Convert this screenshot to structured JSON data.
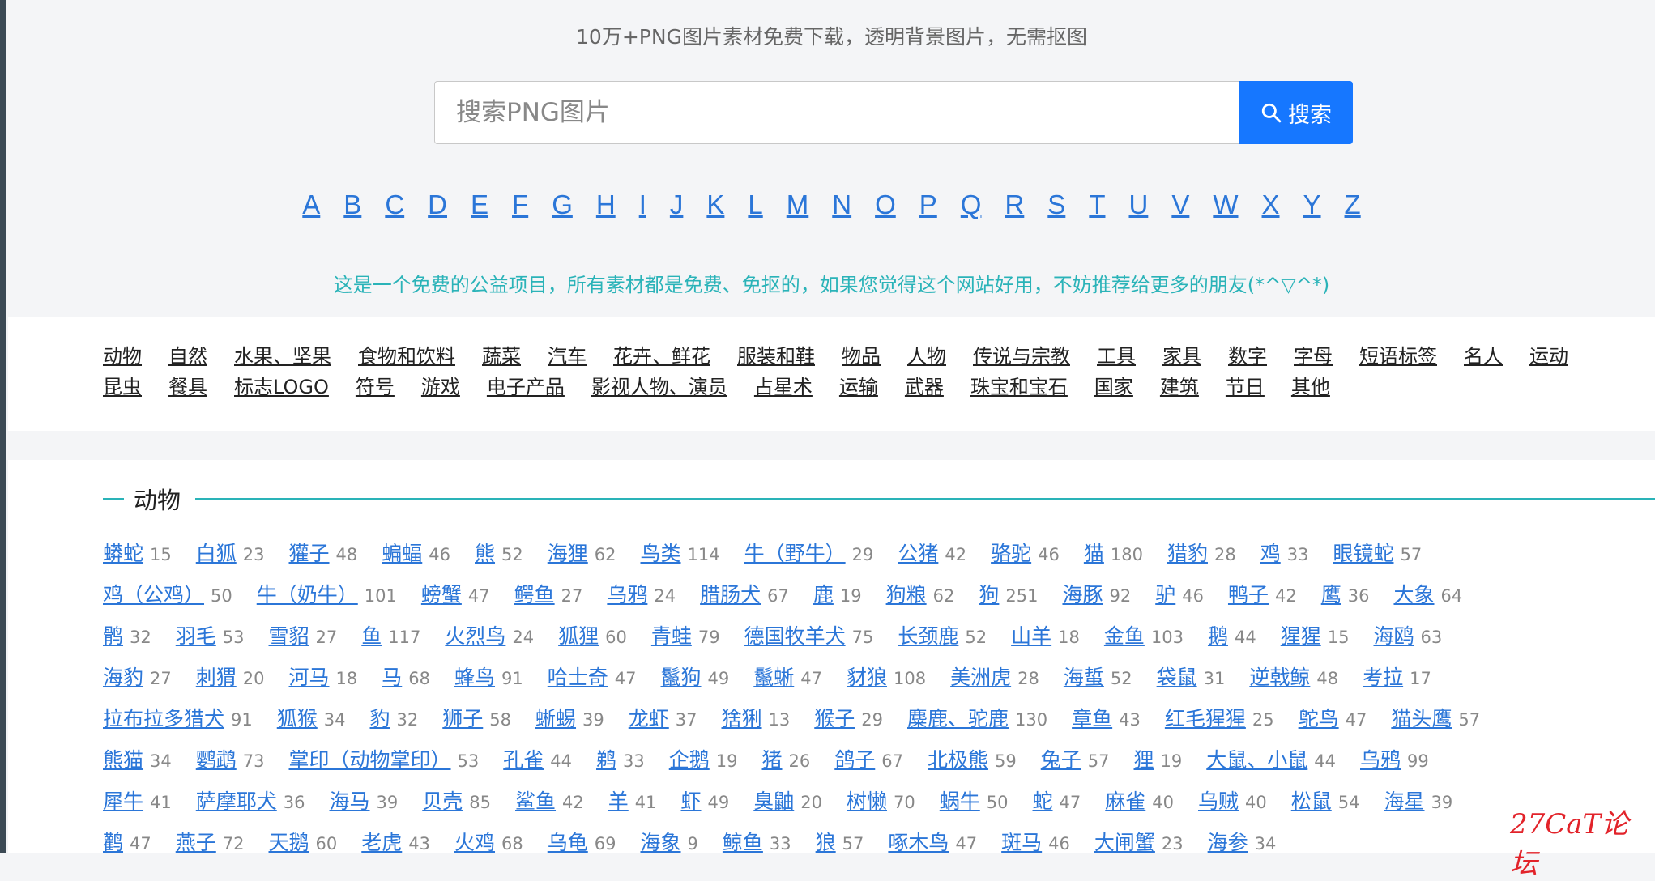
{
  "header": {
    "tagline": "10万+PNG图片素材免费下载，透明背景图片，无需抠图"
  },
  "search": {
    "placeholder": "搜索PNG图片",
    "button_label": "搜索",
    "icon": "search-icon"
  },
  "letters": [
    "A",
    "B",
    "C",
    "D",
    "E",
    "F",
    "G",
    "H",
    "I",
    "J",
    "K",
    "L",
    "M",
    "N",
    "O",
    "P",
    "Q",
    "R",
    "S",
    "T",
    "U",
    "V",
    "W",
    "X",
    "Y",
    "Z"
  ],
  "notice": "这是一个免费的公益项目，所有素材都是免费、免抠的，如果您觉得这个网站好用，不妨推荐给更多的朋友(*^▽^*)",
  "categories": [
    [
      "动物",
      "自然",
      "水果、坚果",
      "食物和饮料",
      "蔬菜",
      "汽车",
      "花卉、鲜花",
      "服装和鞋",
      "物品",
      "人物",
      "传说与宗教",
      "工具",
      "家具",
      "数字",
      "字母",
      "短语标签",
      "名人",
      "运动"
    ],
    [
      "昆虫",
      "餐具",
      "标志LOGO",
      "符号",
      "游戏",
      "电子产品",
      "影视人物、演员",
      "占星术",
      "运输",
      "武器",
      "珠宝和宝石",
      "国家",
      "建筑",
      "节日",
      "其他"
    ]
  ],
  "section": {
    "title": "动物",
    "rows": [
      [
        [
          "蟒蛇",
          "15"
        ],
        [
          "白狐",
          "23"
        ],
        [
          "獾子",
          "48"
        ],
        [
          "蝙蝠",
          "46"
        ],
        [
          "熊",
          "52"
        ],
        [
          "海狸",
          "62"
        ],
        [
          "鸟类",
          "114"
        ],
        [
          "牛（野牛）",
          "29"
        ],
        [
          "公猪",
          "42"
        ],
        [
          "骆驼",
          "46"
        ],
        [
          "猫",
          "180"
        ],
        [
          "猎豹",
          "28"
        ],
        [
          "鸡",
          "33"
        ],
        [
          "眼镜蛇",
          "57"
        ]
      ],
      [
        [
          "鸡（公鸡）",
          "50"
        ],
        [
          "牛（奶牛）",
          "101"
        ],
        [
          "螃蟹",
          "47"
        ],
        [
          "鳄鱼",
          "27"
        ],
        [
          "乌鸦",
          "24"
        ],
        [
          "腊肠犬",
          "67"
        ],
        [
          "鹿",
          "19"
        ],
        [
          "狗粮",
          "62"
        ],
        [
          "狗",
          "251"
        ],
        [
          "海豚",
          "92"
        ],
        [
          "驴",
          "46"
        ],
        [
          "鸭子",
          "42"
        ],
        [
          "鹰",
          "36"
        ],
        [
          "大象",
          "64"
        ]
      ],
      [
        [
          "鹘",
          "32"
        ],
        [
          "羽毛",
          "53"
        ],
        [
          "雪貂",
          "27"
        ],
        [
          "鱼",
          "117"
        ],
        [
          "火烈鸟",
          "24"
        ],
        [
          "狐狸",
          "60"
        ],
        [
          "青蛙",
          "79"
        ],
        [
          "德国牧羊犬",
          "75"
        ],
        [
          "长颈鹿",
          "52"
        ],
        [
          "山羊",
          "18"
        ],
        [
          "金鱼",
          "103"
        ],
        [
          "鹅",
          "44"
        ],
        [
          "猩猩",
          "15"
        ],
        [
          "海鸥",
          "63"
        ]
      ],
      [
        [
          "海豹",
          "27"
        ],
        [
          "刺猬",
          "20"
        ],
        [
          "河马",
          "18"
        ],
        [
          "马",
          "68"
        ],
        [
          "蜂鸟",
          "91"
        ],
        [
          "哈士奇",
          "47"
        ],
        [
          "鬣狗",
          "49"
        ],
        [
          "鬣蜥",
          "47"
        ],
        [
          "豺狼",
          "108"
        ],
        [
          "美洲虎",
          "28"
        ],
        [
          "海蜇",
          "52"
        ],
        [
          "袋鼠",
          "31"
        ],
        [
          "逆戟鲸",
          "48"
        ],
        [
          "考拉",
          "17"
        ]
      ],
      [
        [
          "拉布拉多猎犬",
          "91"
        ],
        [
          "狐猴",
          "34"
        ],
        [
          "豹",
          "32"
        ],
        [
          "狮子",
          "58"
        ],
        [
          "蜥蜴",
          "39"
        ],
        [
          "龙虾",
          "37"
        ],
        [
          "猞猁",
          "13"
        ],
        [
          "猴子",
          "29"
        ],
        [
          "麋鹿、驼鹿",
          "130"
        ],
        [
          "章鱼",
          "43"
        ],
        [
          "红毛猩猩",
          "25"
        ],
        [
          "鸵鸟",
          "47"
        ],
        [
          "猫头鹰",
          "57"
        ]
      ],
      [
        [
          "熊猫",
          "34"
        ],
        [
          "鹦鹉",
          "73"
        ],
        [
          "掌印（动物掌印）",
          "53"
        ],
        [
          "孔雀",
          "44"
        ],
        [
          "鹈",
          "33"
        ],
        [
          "企鹅",
          "19"
        ],
        [
          "猪",
          "26"
        ],
        [
          "鸽子",
          "67"
        ],
        [
          "北极熊",
          "59"
        ],
        [
          "兔子",
          "57"
        ],
        [
          "狸",
          "19"
        ],
        [
          "大鼠、小鼠",
          "44"
        ],
        [
          "乌鸦",
          "99"
        ]
      ],
      [
        [
          "犀牛",
          "41"
        ],
        [
          "萨摩耶犬",
          "36"
        ],
        [
          "海马",
          "39"
        ],
        [
          "贝壳",
          "85"
        ],
        [
          "鲨鱼",
          "42"
        ],
        [
          "羊",
          "41"
        ],
        [
          "虾",
          "49"
        ],
        [
          "臭鼬",
          "20"
        ],
        [
          "树懒",
          "70"
        ],
        [
          "蜗牛",
          "50"
        ],
        [
          "蛇",
          "47"
        ],
        [
          "麻雀",
          "40"
        ],
        [
          "乌贼",
          "40"
        ],
        [
          "松鼠",
          "54"
        ],
        [
          "海星",
          "39"
        ]
      ],
      [
        [
          "鹳",
          "47"
        ],
        [
          "燕子",
          "72"
        ],
        [
          "天鹅",
          "60"
        ],
        [
          "老虎",
          "43"
        ],
        [
          "火鸡",
          "68"
        ],
        [
          "乌龟",
          "69"
        ],
        [
          "海象",
          "9"
        ],
        [
          "鲸鱼",
          "33"
        ],
        [
          "狼",
          "57"
        ],
        [
          "啄木鸟",
          "47"
        ],
        [
          "斑马",
          "46"
        ],
        [
          "大闸蟹",
          "23"
        ],
        [
          "海参",
          "34"
        ]
      ]
    ]
  },
  "watermark": "27CaT论坛"
}
